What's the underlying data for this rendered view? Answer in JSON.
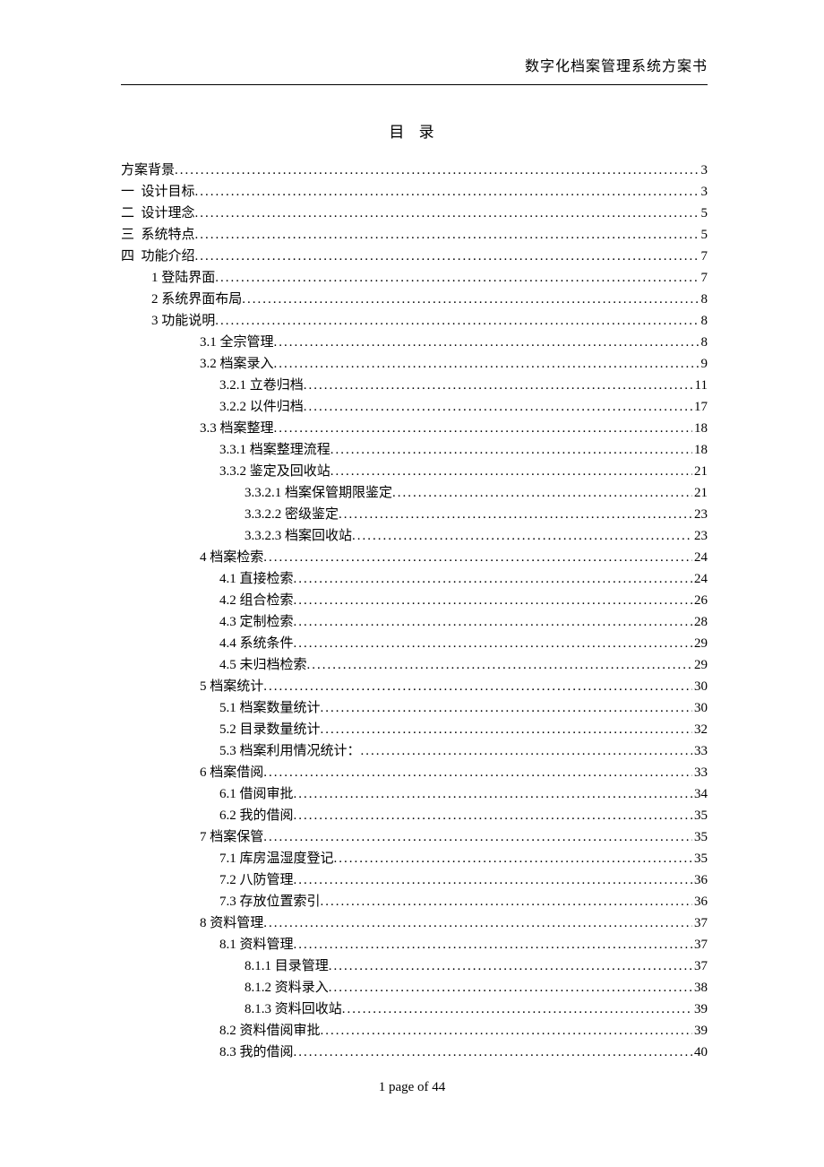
{
  "header": "数字化档案管理系统方案书",
  "toc_title": "目 录",
  "footer": "1 page of 44",
  "entries": [
    {
      "label": "方案背景",
      "page": "3",
      "level": 0
    },
    {
      "label": "一  设计目标",
      "page": "3",
      "level": 0
    },
    {
      "label": "二  设计理念",
      "page": "5",
      "level": 0
    },
    {
      "label": "三  系统特点",
      "page": "5",
      "level": 0
    },
    {
      "label": "四  功能介绍",
      "page": "7",
      "level": 0
    },
    {
      "label": "1 登陆界面",
      "page": "7",
      "level": 1
    },
    {
      "label": "2 系统界面布局",
      "page": "8",
      "level": 1
    },
    {
      "label": "3 功能说明",
      "page": "8",
      "level": 1
    },
    {
      "label": "3.1 全宗管理",
      "page": "8",
      "level": 2
    },
    {
      "label": "3.2 档案录入",
      "page": "9",
      "level": 2
    },
    {
      "label": "3.2.1 立卷归档",
      "page": "11",
      "level": 3
    },
    {
      "label": "3.2.2 以件归档",
      "page": "17",
      "level": 3
    },
    {
      "label": "3.3 档案整理",
      "page": "18",
      "level": 2
    },
    {
      "label": "3.3.1 档案整理流程",
      "page": "18",
      "level": 3
    },
    {
      "label": "3.3.2 鉴定及回收站",
      "page": "21",
      "level": 3
    },
    {
      "label": "3.3.2.1 档案保管期限鉴定",
      "page": "21",
      "level": 4
    },
    {
      "label": "3.3.2.2 密级鉴定",
      "page": "23",
      "level": 4
    },
    {
      "label": "3.3.2.3 档案回收站",
      "page": "23",
      "level": 4
    },
    {
      "label": "4 档案检索",
      "page": "24",
      "level": 2
    },
    {
      "label": "4.1 直接检索",
      "page": "24",
      "level": 3
    },
    {
      "label": "4.2 组合检索",
      "page": "26",
      "level": 3
    },
    {
      "label": "4.3 定制检索",
      "page": "28",
      "level": 3
    },
    {
      "label": "4.4 系统条件",
      "page": "29",
      "level": 3
    },
    {
      "label": "4.5 未归档检索",
      "page": "29",
      "level": 3
    },
    {
      "label": "5 档案统计",
      "page": "30",
      "level": 2
    },
    {
      "label": "5.1 档案数量统计",
      "page": "30",
      "level": 3
    },
    {
      "label": "5.2 目录数量统计",
      "page": "32",
      "level": 3
    },
    {
      "label": "5.3 档案利用情况统计：",
      "page": "33",
      "level": 3
    },
    {
      "label": "6 档案借阅",
      "page": "33",
      "level": 2
    },
    {
      "label": "6.1 借阅审批",
      "page": "34",
      "level": 3
    },
    {
      "label": "6.2 我的借阅",
      "page": "35",
      "level": 3
    },
    {
      "label": "7 档案保管",
      "page": "35",
      "level": 2
    },
    {
      "label": "7.1 库房温湿度登记",
      "page": "35",
      "level": 3
    },
    {
      "label": "7.2 八防管理",
      "page": "36",
      "level": 3
    },
    {
      "label": "7.3 存放位置索引",
      "page": "36",
      "level": 3
    },
    {
      "label": "8 资料管理",
      "page": "37",
      "level": 2
    },
    {
      "label": "8.1 资料管理",
      "page": "37",
      "level": 3
    },
    {
      "label": "8.1.1 目录管理",
      "page": "37",
      "level": 4
    },
    {
      "label": "8.1.2 资料录入",
      "page": "38",
      "level": 4
    },
    {
      "label": "8.1.3 资料回收站",
      "page": "39",
      "level": 4
    },
    {
      "label": "8.2 资料借阅审批",
      "page": "39",
      "level": 3
    },
    {
      "label": "8.3 我的借阅",
      "page": "40",
      "level": 3
    }
  ]
}
